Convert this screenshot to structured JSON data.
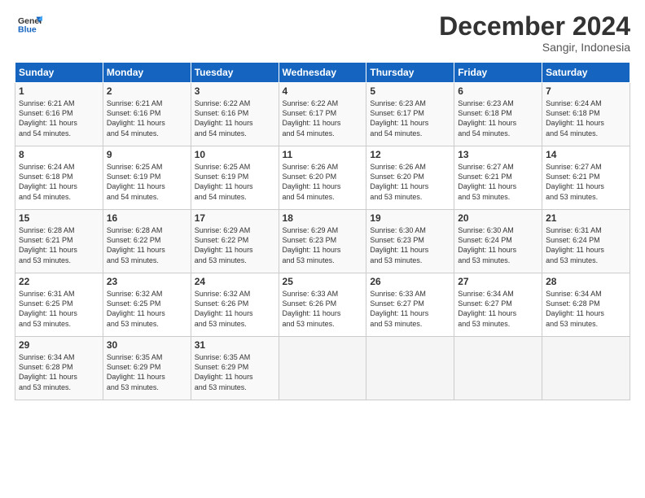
{
  "logo": {
    "line1": "General",
    "line2": "Blue"
  },
  "title": "December 2024",
  "location": "Sangir, Indonesia",
  "days_header": [
    "Sunday",
    "Monday",
    "Tuesday",
    "Wednesday",
    "Thursday",
    "Friday",
    "Saturday"
  ],
  "weeks": [
    [
      {
        "day": "1",
        "info": "Sunrise: 6:21 AM\nSunset: 6:16 PM\nDaylight: 11 hours\nand 54 minutes."
      },
      {
        "day": "2",
        "info": "Sunrise: 6:21 AM\nSunset: 6:16 PM\nDaylight: 11 hours\nand 54 minutes."
      },
      {
        "day": "3",
        "info": "Sunrise: 6:22 AM\nSunset: 6:16 PM\nDaylight: 11 hours\nand 54 minutes."
      },
      {
        "day": "4",
        "info": "Sunrise: 6:22 AM\nSunset: 6:17 PM\nDaylight: 11 hours\nand 54 minutes."
      },
      {
        "day": "5",
        "info": "Sunrise: 6:23 AM\nSunset: 6:17 PM\nDaylight: 11 hours\nand 54 minutes."
      },
      {
        "day": "6",
        "info": "Sunrise: 6:23 AM\nSunset: 6:18 PM\nDaylight: 11 hours\nand 54 minutes."
      },
      {
        "day": "7",
        "info": "Sunrise: 6:24 AM\nSunset: 6:18 PM\nDaylight: 11 hours\nand 54 minutes."
      }
    ],
    [
      {
        "day": "8",
        "info": "Sunrise: 6:24 AM\nSunset: 6:18 PM\nDaylight: 11 hours\nand 54 minutes."
      },
      {
        "day": "9",
        "info": "Sunrise: 6:25 AM\nSunset: 6:19 PM\nDaylight: 11 hours\nand 54 minutes."
      },
      {
        "day": "10",
        "info": "Sunrise: 6:25 AM\nSunset: 6:19 PM\nDaylight: 11 hours\nand 54 minutes."
      },
      {
        "day": "11",
        "info": "Sunrise: 6:26 AM\nSunset: 6:20 PM\nDaylight: 11 hours\nand 54 minutes."
      },
      {
        "day": "12",
        "info": "Sunrise: 6:26 AM\nSunset: 6:20 PM\nDaylight: 11 hours\nand 53 minutes."
      },
      {
        "day": "13",
        "info": "Sunrise: 6:27 AM\nSunset: 6:21 PM\nDaylight: 11 hours\nand 53 minutes."
      },
      {
        "day": "14",
        "info": "Sunrise: 6:27 AM\nSunset: 6:21 PM\nDaylight: 11 hours\nand 53 minutes."
      }
    ],
    [
      {
        "day": "15",
        "info": "Sunrise: 6:28 AM\nSunset: 6:21 PM\nDaylight: 11 hours\nand 53 minutes."
      },
      {
        "day": "16",
        "info": "Sunrise: 6:28 AM\nSunset: 6:22 PM\nDaylight: 11 hours\nand 53 minutes."
      },
      {
        "day": "17",
        "info": "Sunrise: 6:29 AM\nSunset: 6:22 PM\nDaylight: 11 hours\nand 53 minutes."
      },
      {
        "day": "18",
        "info": "Sunrise: 6:29 AM\nSunset: 6:23 PM\nDaylight: 11 hours\nand 53 minutes."
      },
      {
        "day": "19",
        "info": "Sunrise: 6:30 AM\nSunset: 6:23 PM\nDaylight: 11 hours\nand 53 minutes."
      },
      {
        "day": "20",
        "info": "Sunrise: 6:30 AM\nSunset: 6:24 PM\nDaylight: 11 hours\nand 53 minutes."
      },
      {
        "day": "21",
        "info": "Sunrise: 6:31 AM\nSunset: 6:24 PM\nDaylight: 11 hours\nand 53 minutes."
      }
    ],
    [
      {
        "day": "22",
        "info": "Sunrise: 6:31 AM\nSunset: 6:25 PM\nDaylight: 11 hours\nand 53 minutes."
      },
      {
        "day": "23",
        "info": "Sunrise: 6:32 AM\nSunset: 6:25 PM\nDaylight: 11 hours\nand 53 minutes."
      },
      {
        "day": "24",
        "info": "Sunrise: 6:32 AM\nSunset: 6:26 PM\nDaylight: 11 hours\nand 53 minutes."
      },
      {
        "day": "25",
        "info": "Sunrise: 6:33 AM\nSunset: 6:26 PM\nDaylight: 11 hours\nand 53 minutes."
      },
      {
        "day": "26",
        "info": "Sunrise: 6:33 AM\nSunset: 6:27 PM\nDaylight: 11 hours\nand 53 minutes."
      },
      {
        "day": "27",
        "info": "Sunrise: 6:34 AM\nSunset: 6:27 PM\nDaylight: 11 hours\nand 53 minutes."
      },
      {
        "day": "28",
        "info": "Sunrise: 6:34 AM\nSunset: 6:28 PM\nDaylight: 11 hours\nand 53 minutes."
      }
    ],
    [
      {
        "day": "29",
        "info": "Sunrise: 6:34 AM\nSunset: 6:28 PM\nDaylight: 11 hours\nand 53 minutes."
      },
      {
        "day": "30",
        "info": "Sunrise: 6:35 AM\nSunset: 6:29 PM\nDaylight: 11 hours\nand 53 minutes."
      },
      {
        "day": "31",
        "info": "Sunrise: 6:35 AM\nSunset: 6:29 PM\nDaylight: 11 hours\nand 53 minutes."
      },
      {
        "day": "",
        "info": ""
      },
      {
        "day": "",
        "info": ""
      },
      {
        "day": "",
        "info": ""
      },
      {
        "day": "",
        "info": ""
      }
    ]
  ]
}
